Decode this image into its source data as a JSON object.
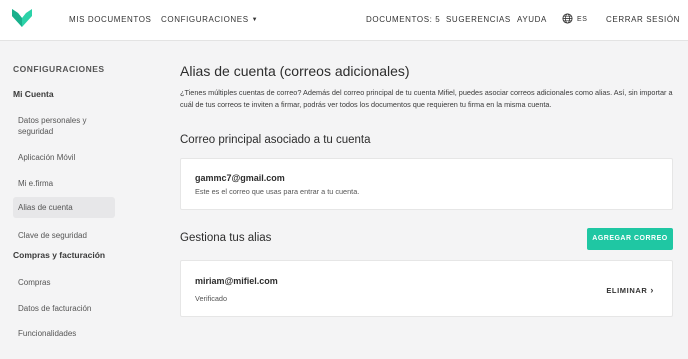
{
  "nav": {
    "documents": "MIS DOCUMENTOS",
    "settings": "CONFIGURACIONES",
    "documents_count": "DOCUMENTOS: 5",
    "suggestions": "SUGERENCIAS",
    "help": "AYUDA",
    "language": "ES",
    "logout": "CERRAR SESIÓN"
  },
  "sidebar": {
    "heading": "CONFIGURACIONES",
    "account_section": "Mi Cuenta",
    "account_items": [
      "Datos personales y seguridad",
      "Aplicación Móvil",
      "Mi e.firma",
      "Alias de cuenta",
      "Clave de seguridad"
    ],
    "active_item": "Alias de cuenta",
    "billing_section": "Compras y facturación",
    "billing_items": [
      "Compras",
      "Datos de facturación",
      "Funcionalidades"
    ]
  },
  "main": {
    "title": "Alias de cuenta (correos adicionales)",
    "description": "¿Tienes múltiples cuentas de correo? Además del correo principal de tu cuenta Mifiel, puedes asociar correos adicionales como alias. Así, sin importar a cuál de tus correos te inviten a firmar, podrás ver todos los documentos que requieren tu firma en la misma cuenta.",
    "primary_section_title": "Correo principal asociado a tu cuenta",
    "primary_email": "gammc7@gmail.com",
    "primary_email_note": "Este es el correo que usas para entrar a tu cuenta.",
    "aliases_section_title": "Gestiona tus alias",
    "add_button": "AGREGAR CORREO",
    "aliases": [
      {
        "email": "miriam@mifiel.com",
        "status": "Verificado",
        "action": "ELIMINAR"
      }
    ]
  },
  "colors": {
    "accent": "#1fc7a3",
    "logo": "#2bd2a8",
    "background": "#f4f4f5"
  },
  "icons": {
    "logo": "mifiel-logo",
    "language": "globe-icon",
    "settings_dropdown": "chevron-down-icon",
    "delete": "chevron-right-icon"
  }
}
